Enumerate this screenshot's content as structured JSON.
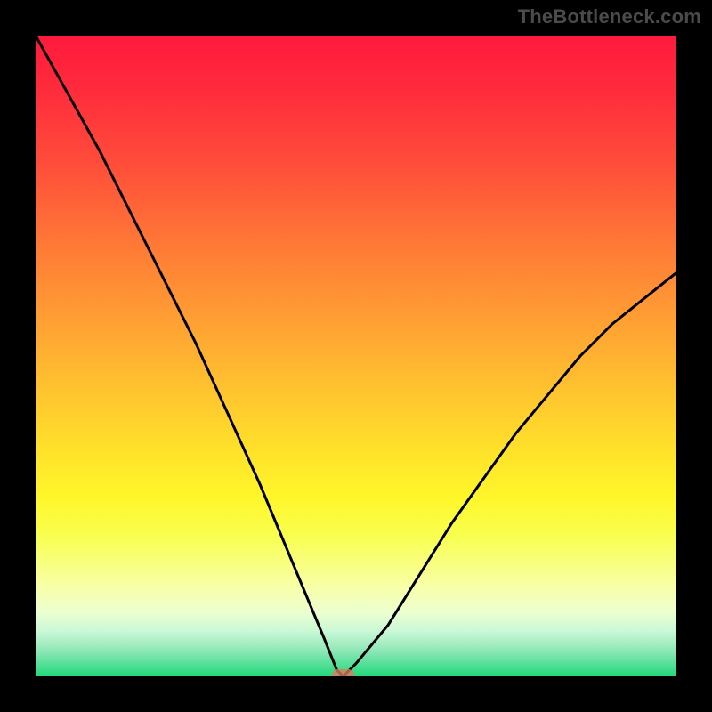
{
  "branding": {
    "watermark": "TheBottleneck.com"
  },
  "chart_data": {
    "type": "line",
    "title": "",
    "xlabel": "",
    "ylabel": "",
    "x": [
      0,
      5,
      10,
      15,
      20,
      25,
      30,
      35,
      40,
      45,
      47,
      48,
      50,
      55,
      60,
      65,
      70,
      75,
      80,
      85,
      90,
      95,
      100
    ],
    "values": [
      100,
      91,
      82,
      72,
      62,
      52,
      41,
      30,
      18,
      6,
      1,
      0,
      2,
      8,
      16,
      24,
      31,
      38,
      44,
      50,
      55,
      59,
      63
    ],
    "marker": {
      "x": 48,
      "y": 0
    },
    "xlim": [
      0,
      100
    ],
    "ylim": [
      0,
      100
    ],
    "grid": false,
    "legend": false,
    "background_gradient": {
      "orientation": "vertical",
      "stops": [
        {
          "pos": 0.0,
          "color": "#ff1a3c"
        },
        {
          "pos": 0.33,
          "color": "#ff7a36"
        },
        {
          "pos": 0.66,
          "color": "#ffe22a"
        },
        {
          "pos": 0.9,
          "color": "#ecffd0"
        },
        {
          "pos": 1.0,
          "color": "#1fd97a"
        }
      ]
    }
  }
}
